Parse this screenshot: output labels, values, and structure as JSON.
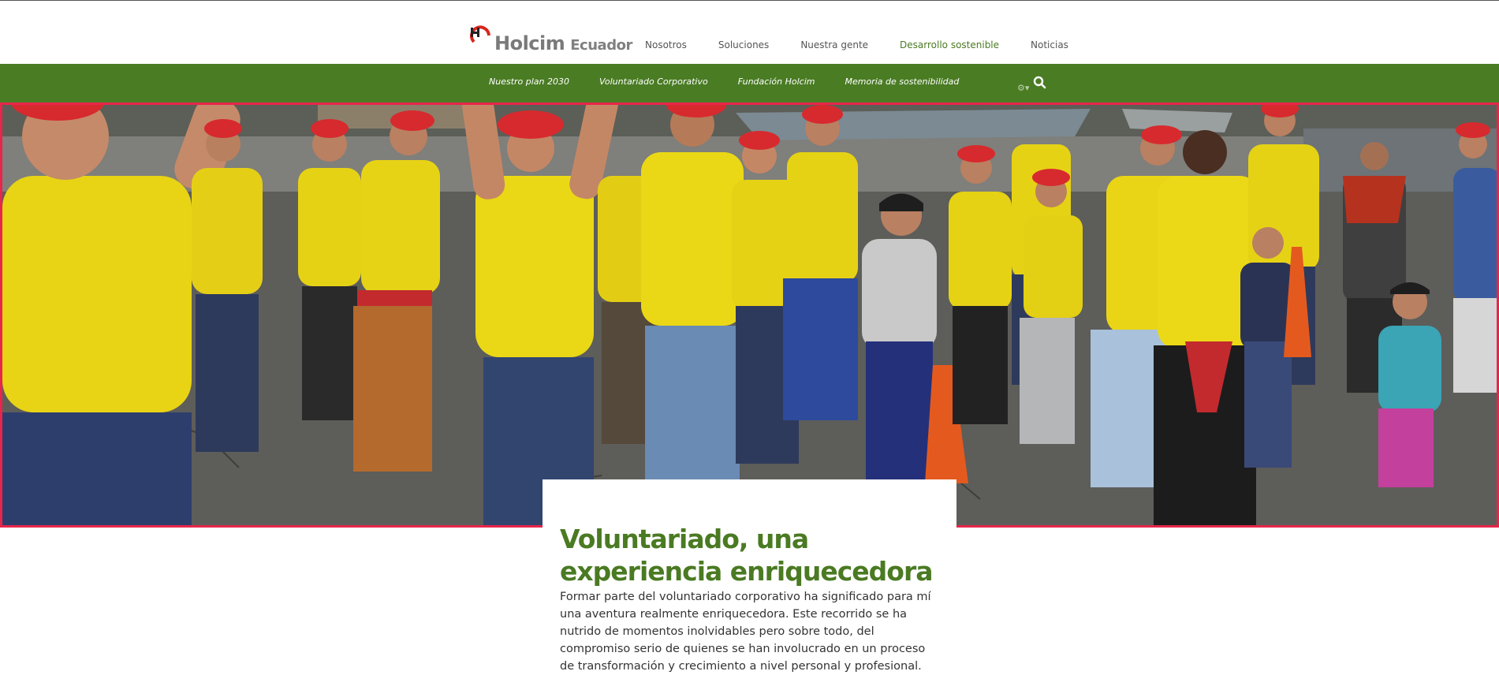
{
  "header": {
    "logo_brand": "Holcim",
    "logo_country": "Ecuador",
    "nav": [
      {
        "label": "Nosotros",
        "active": false
      },
      {
        "label": "Soluciones",
        "active": false
      },
      {
        "label": "Nuestra gente",
        "active": false
      },
      {
        "label": "Desarrollo sostenible",
        "active": true
      },
      {
        "label": "Noticias",
        "active": false
      }
    ]
  },
  "subnav": {
    "items": [
      {
        "label": "Nuestro plan 2030"
      },
      {
        "label": "Voluntariado Corporativo"
      },
      {
        "label": "Fundación Holcim"
      },
      {
        "label": "Memoria de sostenibilidad"
      }
    ],
    "icons": [
      "settings-icon",
      "search-icon"
    ]
  },
  "hero": {
    "image": "volunteers-dancing-photo"
  },
  "article": {
    "title": "Voluntariado, una experiencia enriquecedora",
    "body": "Formar parte del voluntariado corporativo ha significado para mí una aventura realmente enriquecedora. Este recorrido se ha nutrido de momentos inolvidables pero sobre todo, del compromiso serio de quienes se han involucrado en un proceso de transformación y crecimiento a nivel personal y profesional."
  },
  "colors": {
    "brand_green": "#4a7c24",
    "title_green": "#4a7a22",
    "highlight_border": "#e8254a",
    "logo_red": "#d7261e"
  }
}
